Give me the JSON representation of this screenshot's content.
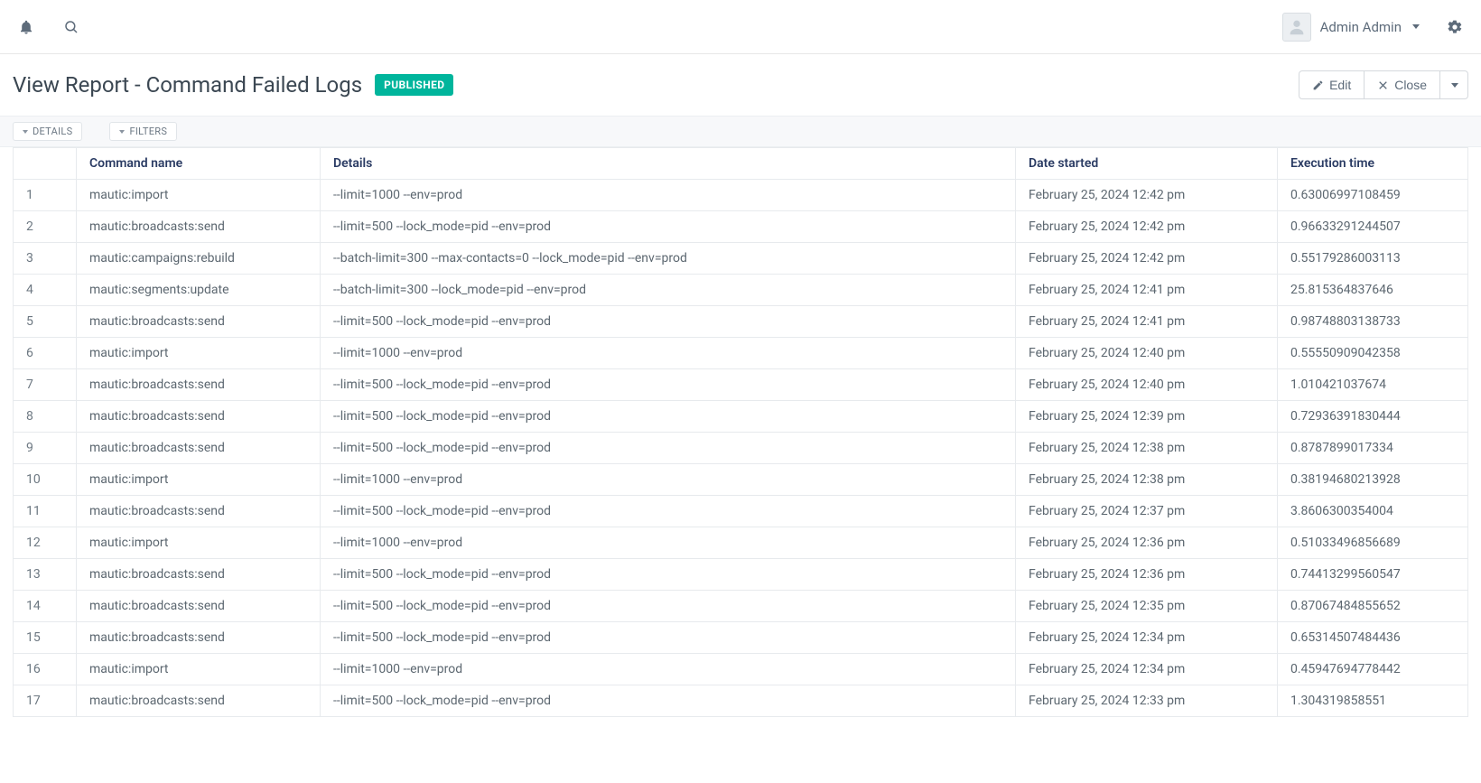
{
  "topbar": {
    "user_name": "Admin Admin"
  },
  "header": {
    "title": "View Report - Command Failed Logs",
    "badge": "PUBLISHED",
    "edit_label": "Edit",
    "close_label": "Close"
  },
  "subtabs": {
    "details": "DETAILS",
    "filters": "FILTERS"
  },
  "table": {
    "columns": {
      "command": "Command name",
      "details": "Details",
      "date": "Date started",
      "exec": "Execution time"
    },
    "rows": [
      {
        "n": "1",
        "cmd": "mautic:import",
        "det": "--limit=1000 --env=prod",
        "date": "February 25, 2024 12:42 pm",
        "exec": "0.63006997108459"
      },
      {
        "n": "2",
        "cmd": "mautic:broadcasts:send",
        "det": "--limit=500 --lock_mode=pid --env=prod",
        "date": "February 25, 2024 12:42 pm",
        "exec": "0.96633291244507"
      },
      {
        "n": "3",
        "cmd": "mautic:campaigns:rebuild",
        "det": "--batch-limit=300 --max-contacts=0 --lock_mode=pid --env=prod",
        "date": "February 25, 2024 12:42 pm",
        "exec": "0.55179286003113"
      },
      {
        "n": "4",
        "cmd": "mautic:segments:update",
        "det": "--batch-limit=300 --lock_mode=pid --env=prod",
        "date": "February 25, 2024 12:41 pm",
        "exec": "25.815364837646"
      },
      {
        "n": "5",
        "cmd": "mautic:broadcasts:send",
        "det": "--limit=500 --lock_mode=pid --env=prod",
        "date": "February 25, 2024 12:41 pm",
        "exec": "0.98748803138733"
      },
      {
        "n": "6",
        "cmd": "mautic:import",
        "det": "--limit=1000 --env=prod",
        "date": "February 25, 2024 12:40 pm",
        "exec": "0.55550909042358"
      },
      {
        "n": "7",
        "cmd": "mautic:broadcasts:send",
        "det": "--limit=500 --lock_mode=pid --env=prod",
        "date": "February 25, 2024 12:40 pm",
        "exec": "1.010421037674"
      },
      {
        "n": "8",
        "cmd": "mautic:broadcasts:send",
        "det": "--limit=500 --lock_mode=pid --env=prod",
        "date": "February 25, 2024 12:39 pm",
        "exec": "0.72936391830444"
      },
      {
        "n": "9",
        "cmd": "mautic:broadcasts:send",
        "det": "--limit=500 --lock_mode=pid --env=prod",
        "date": "February 25, 2024 12:38 pm",
        "exec": "0.8787899017334"
      },
      {
        "n": "10",
        "cmd": "mautic:import",
        "det": "--limit=1000 --env=prod",
        "date": "February 25, 2024 12:38 pm",
        "exec": "0.38194680213928"
      },
      {
        "n": "11",
        "cmd": "mautic:broadcasts:send",
        "det": "--limit=500 --lock_mode=pid --env=prod",
        "date": "February 25, 2024 12:37 pm",
        "exec": "3.8606300354004"
      },
      {
        "n": "12",
        "cmd": "mautic:import",
        "det": "--limit=1000 --env=prod",
        "date": "February 25, 2024 12:36 pm",
        "exec": "0.51033496856689"
      },
      {
        "n": "13",
        "cmd": "mautic:broadcasts:send",
        "det": "--limit=500 --lock_mode=pid --env=prod",
        "date": "February 25, 2024 12:36 pm",
        "exec": "0.74413299560547"
      },
      {
        "n": "14",
        "cmd": "mautic:broadcasts:send",
        "det": "--limit=500 --lock_mode=pid --env=prod",
        "date": "February 25, 2024 12:35 pm",
        "exec": "0.87067484855652"
      },
      {
        "n": "15",
        "cmd": "mautic:broadcasts:send",
        "det": "--limit=500 --lock_mode=pid --env=prod",
        "date": "February 25, 2024 12:34 pm",
        "exec": "0.65314507484436"
      },
      {
        "n": "16",
        "cmd": "mautic:import",
        "det": "--limit=1000 --env=prod",
        "date": "February 25, 2024 12:34 pm",
        "exec": "0.45947694778442"
      },
      {
        "n": "17",
        "cmd": "mautic:broadcasts:send",
        "det": "--limit=500 --lock_mode=pid --env=prod",
        "date": "February 25, 2024 12:33 pm",
        "exec": "1.304319858551"
      }
    ]
  }
}
